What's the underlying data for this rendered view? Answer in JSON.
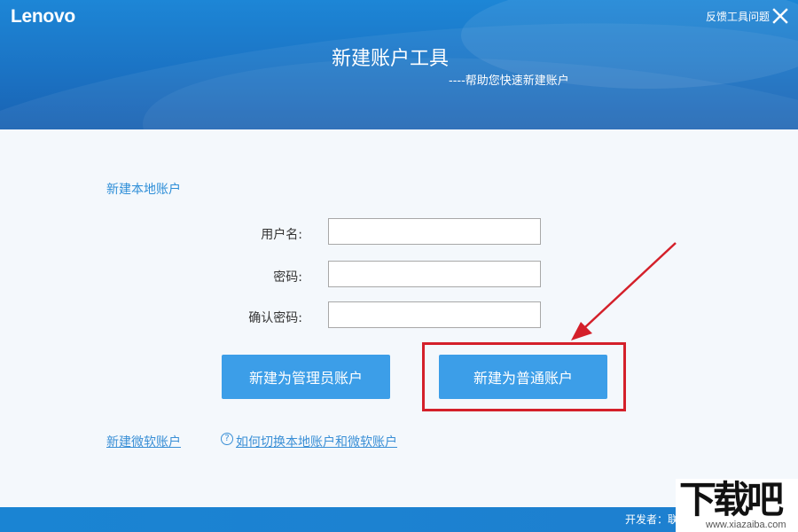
{
  "header": {
    "logo_text": "Lenovo",
    "feedback_label": "反馈工具问题",
    "title": "新建账户工具",
    "subtitle": "----帮助您快速新建账户"
  },
  "section": {
    "title": "新建本地账户"
  },
  "form": {
    "username_label": "用户名:",
    "password_label": "密码:",
    "confirm_label": "确认密码:",
    "username_value": "",
    "password_value": "",
    "confirm_value": ""
  },
  "buttons": {
    "admin_label": "新建为管理员账户",
    "standard_label": "新建为普通账户"
  },
  "links": {
    "microsoft_account": "新建微软账户",
    "help_icon": "?",
    "switch_help": "如何切换本地账户和微软账户"
  },
  "footer": {
    "developer": "开发者：联"
  },
  "watermark": {
    "big_text": "下载吧",
    "url_text": "www.xiazaiba.com"
  },
  "colors": {
    "header_blue": "#1b73c4",
    "button_blue": "#3c9ee8",
    "link_blue": "#3a8fd6",
    "annotation_red": "#d4202a"
  },
  "icons": [
    "close-icon",
    "help-icon",
    "annotation-arrow"
  ]
}
